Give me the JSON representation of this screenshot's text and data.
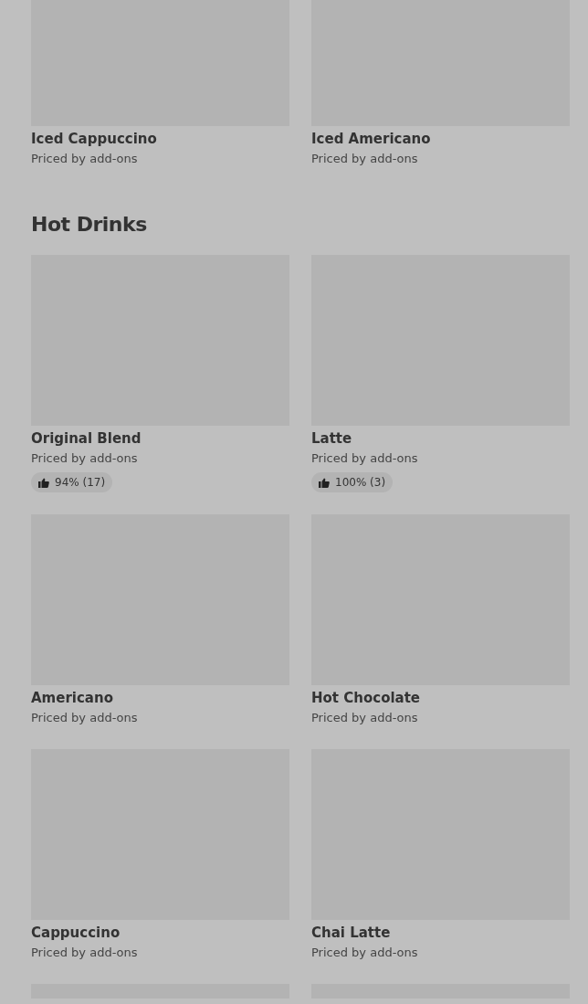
{
  "previous_items": [
    {
      "name": "Iced Cappuccino",
      "price": "Priced by add-ons"
    },
    {
      "name": "Iced Americano",
      "price": "Priced by add-ons"
    }
  ],
  "sections": [
    {
      "title": "Hot Drinks",
      "items": [
        {
          "name": "Original Blend",
          "price": "Priced by add-ons",
          "rating": "94% (17)"
        },
        {
          "name": "Latte",
          "price": "Priced by add-ons",
          "rating": "100% (3)"
        },
        {
          "name": "Americano",
          "price": "Priced by add-ons"
        },
        {
          "name": "Hot Chocolate",
          "price": "Priced by add-ons"
        },
        {
          "name": "Cappuccino",
          "price": "Priced by add-ons"
        },
        {
          "name": "Chai Latte",
          "price": "Priced by add-ons"
        },
        {
          "kind": "picture"
        },
        {
          "kind": "picture"
        }
      ]
    }
  ]
}
